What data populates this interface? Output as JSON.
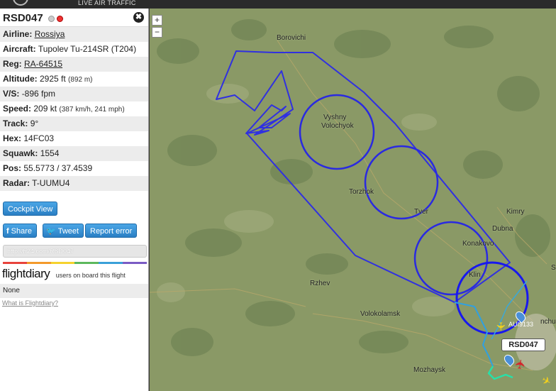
{
  "header": {
    "tagline": "LIVE AIR TRAFFIC"
  },
  "panel": {
    "flight_id": "RSD047",
    "close_glyph": "✖",
    "rows": [
      {
        "label": "Airline:",
        "value": "Rossiya"
      },
      {
        "label": "Aircraft:",
        "value": "Tupolev Tu-214SR (T204)"
      },
      {
        "label": "Reg:",
        "value": "RA-64515"
      },
      {
        "label": "Altitude:",
        "value": "2925 ft",
        "extra": "(892 m)"
      },
      {
        "label": "V/S:",
        "value": "-896 fpm"
      },
      {
        "label": "Speed:",
        "value": "209 kt",
        "extra": "(387 km/h, 241 mph)"
      },
      {
        "label": "Track:",
        "value": "9°"
      },
      {
        "label": "Hex:",
        "value": "14FC03"
      },
      {
        "label": "Squawk:",
        "value": "1554"
      },
      {
        "label": "Pos:",
        "value": "55.5773 / 37.4539"
      },
      {
        "label": "Radar:",
        "value": "T-UUMU4"
      }
    ],
    "cockpit_button": "Cockpit View",
    "share_button": "Share",
    "tweet_button": "Tweet",
    "report_button": "Report error",
    "share_url": "http://fr24.com/RSD047",
    "flightdiary_logo": "flightdiary",
    "flightdiary_text": "users on board this flight",
    "flightdiary_none": "None",
    "flightdiary_link": "What is Flightdiary?",
    "stripe_colors": [
      "#e8433c",
      "#f39a2b",
      "#f5d22e",
      "#5cb85c",
      "#3aa0d8",
      "#7a5bc4"
    ]
  },
  "map": {
    "zoom_in": "+",
    "zoom_out": "−",
    "cities": {
      "borovichi": "Borovichi",
      "vyshny": "Vyshny",
      "volochyok": "Volochyok",
      "torzhok": "Torzhok",
      "tver": "Tver",
      "kimry": "Kimry",
      "dubna": "Dubna",
      "konakovo": "Konakovo",
      "klin": "Klin",
      "rzhev": "Rzhev",
      "volokolamsk": "Volokolamsk",
      "mozhaysk": "Mozhaysk",
      "nchu": "nchu",
      "s_edge": "S"
    },
    "other_flight_label": "AUI9133",
    "callout_label": "RSD047",
    "track_color": "#2222dd"
  }
}
